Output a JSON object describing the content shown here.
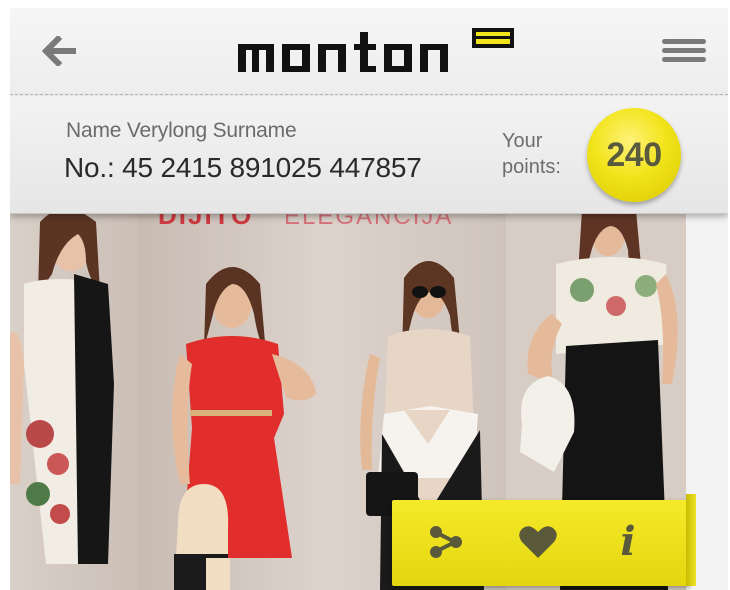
{
  "header": {
    "back_icon": "arrow-left-icon",
    "brand": "monton",
    "menu_icon": "hamburger-menu-icon",
    "accent": "#f2e41a"
  },
  "user": {
    "name": "Name Verylong Surname",
    "number": "No.: 45 2415 891025 447857",
    "points_label_line1": "Your",
    "points_label_line2": "points:",
    "points": "240"
  },
  "banner": {
    "text_bold": "DIJITO",
    "text_light": "ELEGANCIJA"
  },
  "actions": [
    {
      "icon": "share-icon"
    },
    {
      "icon": "heart-icon"
    },
    {
      "icon": "info-icon",
      "glyph": "i"
    }
  ],
  "colors": {
    "brand_yellow": "#f2e41a",
    "dress_red": "#e12b2b",
    "text_dark": "#2a2a2a"
  }
}
